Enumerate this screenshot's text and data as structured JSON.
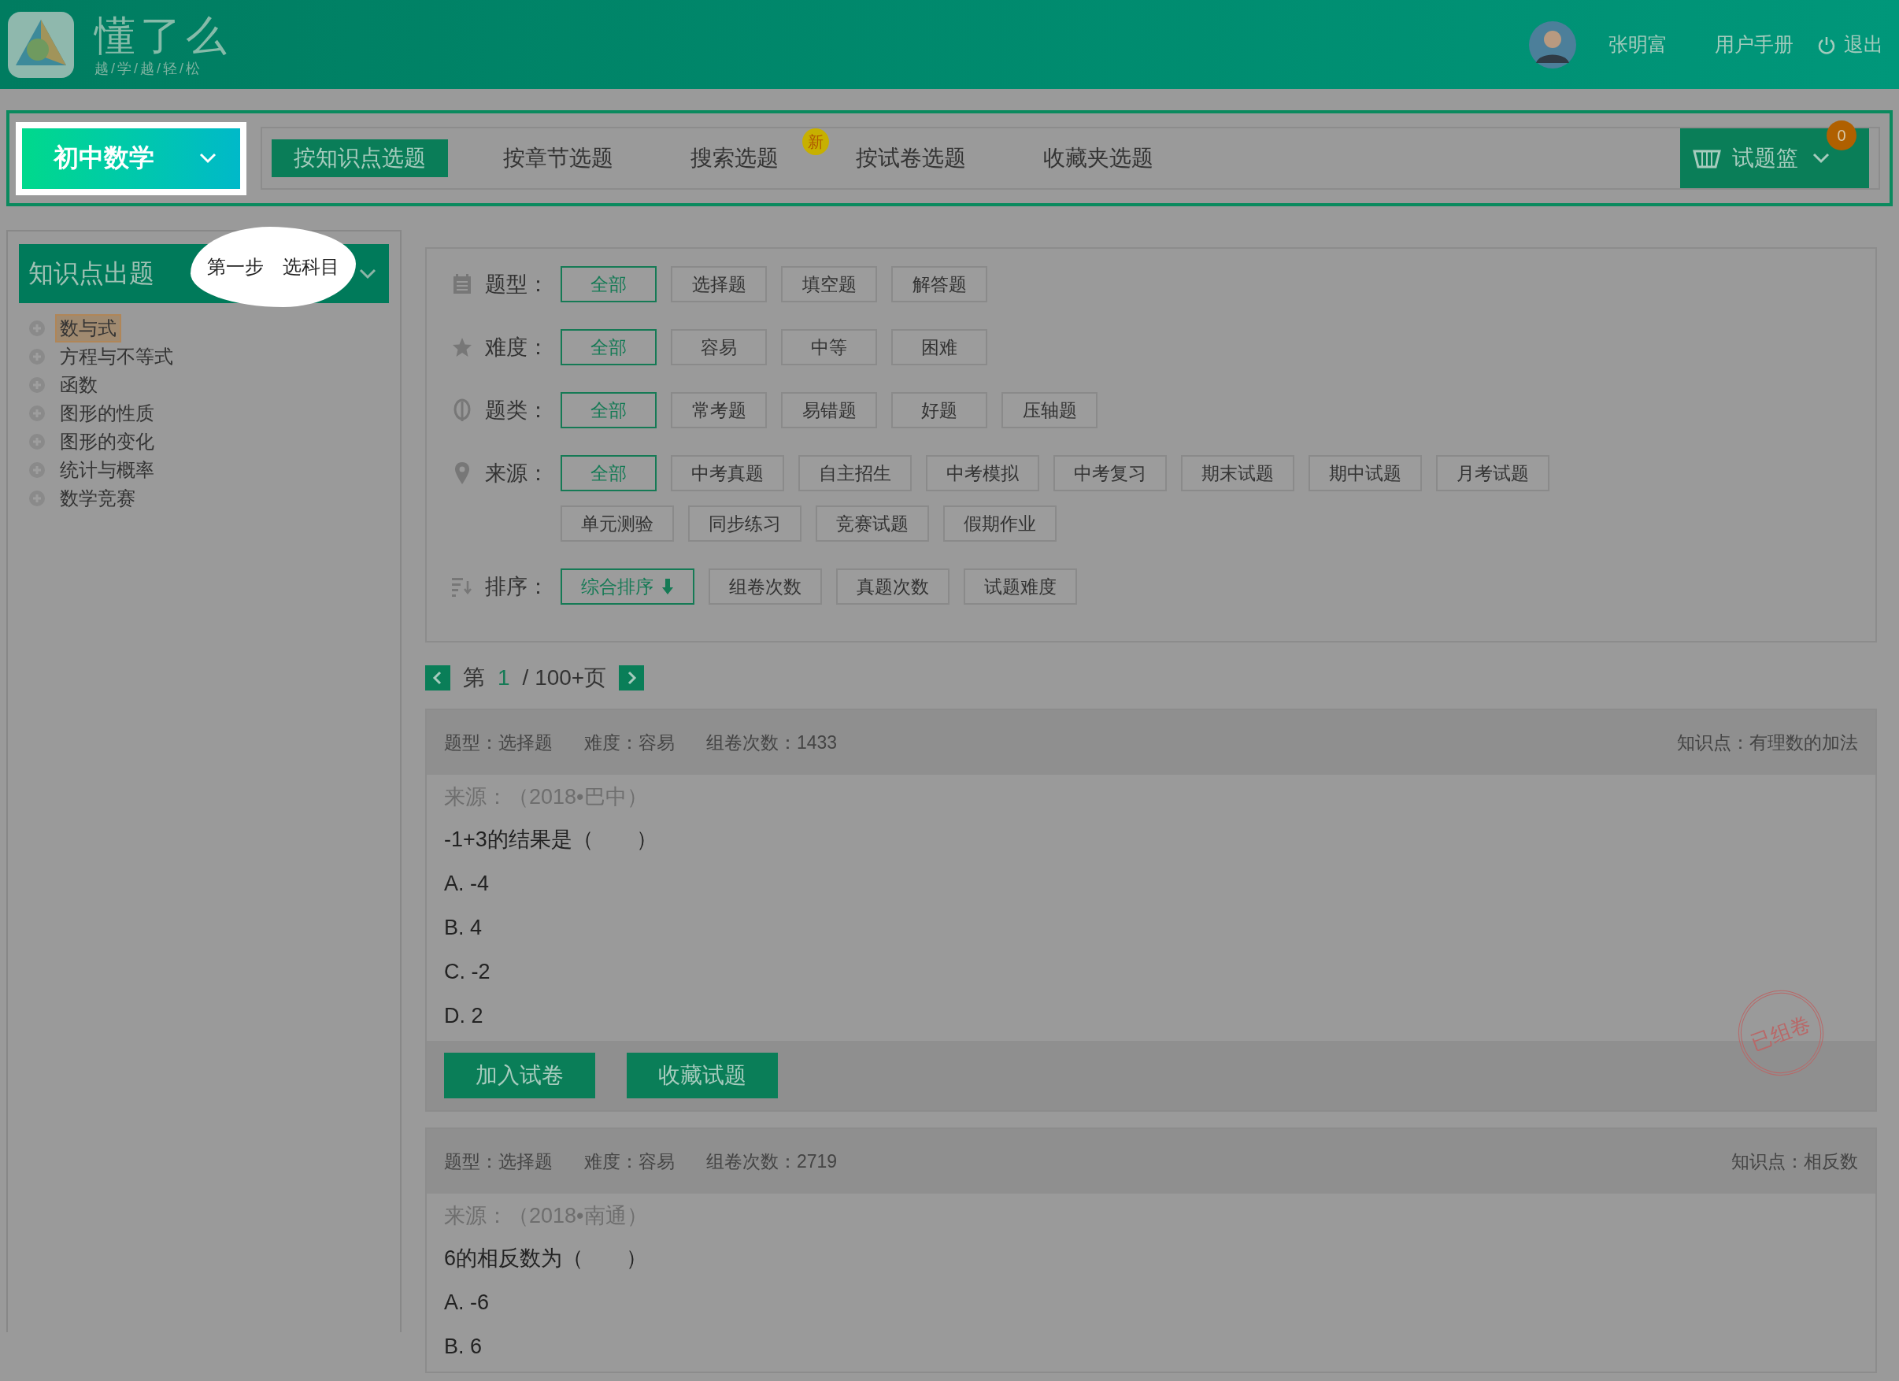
{
  "header": {
    "logo_title": "懂了么",
    "logo_slogan": "越/学/越/轻/松",
    "user_name": "张明富",
    "links": [
      {
        "label": "用户手册",
        "kind": "link"
      },
      {
        "label": "退出",
        "kind": "logout"
      }
    ]
  },
  "subject_selector": {
    "label": "初中数学"
  },
  "nav_tabs": [
    {
      "label": "按知识点选题",
      "selected": true
    },
    {
      "label": "按章节选题",
      "selected": false
    },
    {
      "label": "搜索选题",
      "selected": false,
      "badge": "新"
    },
    {
      "label": "按试卷选题",
      "selected": false
    },
    {
      "label": "收藏夹选题",
      "selected": false
    }
  ],
  "basket": {
    "label": "试题篮",
    "count": "0"
  },
  "sidebar": {
    "title": "知识点出题",
    "tip": "第一步　选科目",
    "items": [
      {
        "label": "数与式",
        "selected": true
      },
      {
        "label": "方程与不等式",
        "selected": false
      },
      {
        "label": "函数",
        "selected": false
      },
      {
        "label": "图形的性质",
        "selected": false
      },
      {
        "label": "图形的变化",
        "selected": false
      },
      {
        "label": "统计与概率",
        "selected": false
      },
      {
        "label": "数学竞赛",
        "selected": false
      }
    ]
  },
  "filters": [
    {
      "kind": "type",
      "label": "题型：",
      "options": [
        {
          "label": "全部",
          "selected": true
        },
        {
          "label": "选择题",
          "selected": false
        },
        {
          "label": "填空题",
          "selected": false
        },
        {
          "label": "解答题",
          "selected": false
        }
      ]
    },
    {
      "kind": "difficulty",
      "label": "难度：",
      "options": [
        {
          "label": "全部",
          "selected": true
        },
        {
          "label": "容易",
          "selected": false
        },
        {
          "label": "中等",
          "selected": false
        },
        {
          "label": "困难",
          "selected": false
        }
      ]
    },
    {
      "kind": "category",
      "label": "题类：",
      "options": [
        {
          "label": "全部",
          "selected": true
        },
        {
          "label": "常考题",
          "selected": false
        },
        {
          "label": "易错题",
          "selected": false
        },
        {
          "label": "好题",
          "selected": false
        },
        {
          "label": "压轴题",
          "selected": false
        }
      ]
    },
    {
      "kind": "source",
      "label": "来源：",
      "options": [
        {
          "label": "全部",
          "selected": true
        },
        {
          "label": "中考真题",
          "selected": false
        },
        {
          "label": "自主招生",
          "selected": false
        },
        {
          "label": "中考模拟",
          "selected": false
        },
        {
          "label": "中考复习",
          "selected": false
        },
        {
          "label": "期末试题",
          "selected": false
        },
        {
          "label": "期中试题",
          "selected": false
        },
        {
          "label": "月考试题",
          "selected": false
        },
        {
          "label": "单元测验",
          "selected": false
        },
        {
          "label": "同步练习",
          "selected": false
        },
        {
          "label": "竞赛试题",
          "selected": false
        },
        {
          "label": "假期作业",
          "selected": false
        }
      ]
    },
    {
      "kind": "sort",
      "label": "排序：",
      "options": [
        {
          "label": "综合排序",
          "selected": true,
          "descending": true
        },
        {
          "label": "组卷次数",
          "selected": false
        },
        {
          "label": "真题次数",
          "selected": false
        },
        {
          "label": "试题难度",
          "selected": false
        }
      ]
    }
  ],
  "pagination": {
    "prefix": "第",
    "current": "1",
    "suffix": "/ 100+页"
  },
  "questions": [
    {
      "type": "题型：选择题",
      "difficulty": "难度：容易",
      "uses": "组卷次数：1433",
      "knowledge": "知识点：有理数的加法",
      "source": "来源：（2018•巴中）",
      "stem": "-1+3的结果是（　　）",
      "options": [
        "A. -4",
        "B. 4",
        "C. -2",
        "D. 2"
      ],
      "buttons": [
        "加入试卷",
        "收藏试题"
      ],
      "stamp": "已组卷"
    },
    {
      "type": "题型：选择题",
      "difficulty": "难度：容易",
      "uses": "组卷次数：2719",
      "knowledge": "知识点：相反数",
      "source": "来源：（2018•南通）",
      "stem": "6的相反数为（　　）",
      "options": [
        "A. -6",
        "B. 6"
      ]
    }
  ]
}
